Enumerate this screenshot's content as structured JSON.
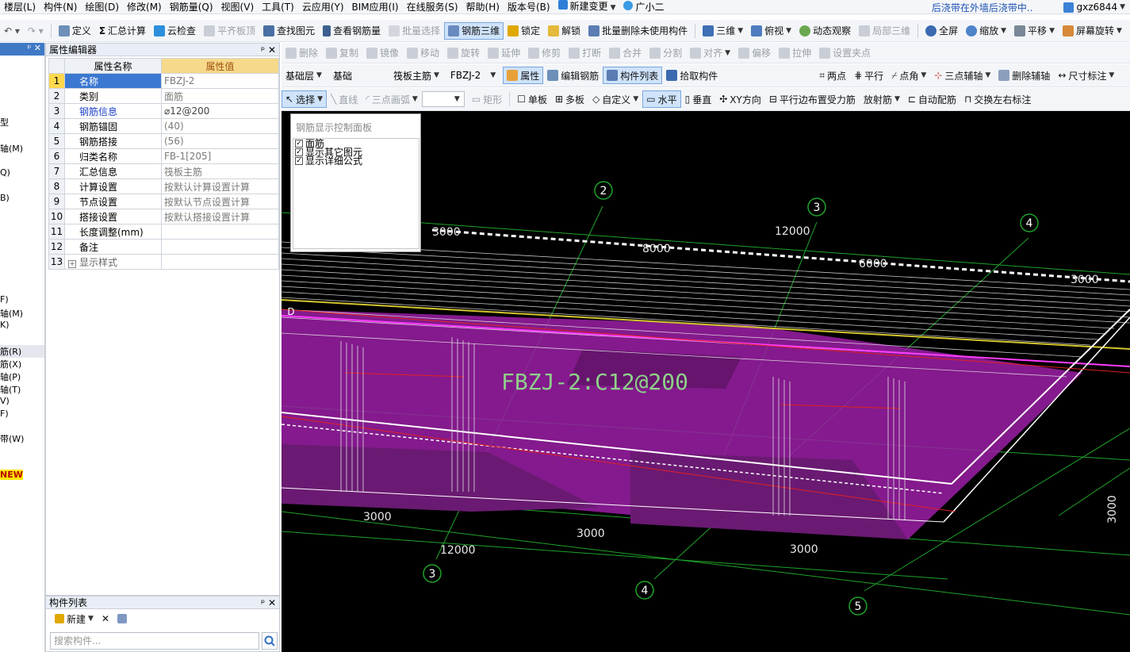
{
  "menubar": {
    "items": [
      "楼层(L)",
      "构件(N)",
      "绘图(D)",
      "修改(M)",
      "钢筋量(Q)",
      "视图(V)",
      "工具(T)",
      "云应用(Y)",
      "BIM应用(I)",
      "在线服务(S)",
      "帮助(H)",
      "版本号(B)",
      "新建变更",
      "广小二"
    ],
    "notice": "后浇带在外墙后浇带中..",
    "user": "gxz6844"
  },
  "toolbar1": {
    "items": [
      "定义",
      "汇总计算",
      "云检查",
      "平齐板顶",
      "查找图元",
      "查看钢筋量",
      "批量选择",
      "钢筋三维",
      "锁定",
      "解锁",
      "批量删除未使用构件",
      "三维",
      "俯视",
      "动态观察",
      "局部三维",
      "全屏",
      "缩放",
      "平移",
      "屏幕旋转"
    ]
  },
  "toolbar2": {
    "items": [
      "删除",
      "复制",
      "镜像",
      "移动",
      "旋转",
      "延伸",
      "修剪",
      "打断",
      "合并",
      "分割",
      "对齐",
      "偏移",
      "拉伸",
      "设置夹点"
    ]
  },
  "toolbar3": {
    "combos": [
      "基础层",
      "基础",
      "筏板主筋",
      "FBZJ-2"
    ],
    "items": [
      "属性",
      "编辑钢筋",
      "构件列表",
      "拾取构件",
      "两点",
      "平行",
      "点角",
      "三点辅轴",
      "删除辅轴",
      "尺寸标注"
    ]
  },
  "toolbar4": {
    "items": [
      "选择",
      "直线",
      "三点画弧",
      "矩形",
      "单板",
      "多板",
      "自定义",
      "水平",
      "垂直",
      "XY方向",
      "平行边布置受力筋",
      "放射筋",
      "自动配筋",
      "交换左右标注"
    ]
  },
  "left_pane": {
    "rows": [
      "型",
      "轴(M)",
      "Q)",
      "B)",
      "F)",
      "轴(M)",
      "K)",
      "筋(R)",
      "筋(X)",
      "轴(P)",
      "轴(T)",
      "V)",
      "F)",
      "带(W)",
      "NEW"
    ]
  },
  "property_editor": {
    "title": "属性编辑器",
    "col_name": "属性名称",
    "col_value": "属性值",
    "rows": [
      {
        "n": "1",
        "name": "名称",
        "value": "FBZJ-2"
      },
      {
        "n": "2",
        "name": "类别",
        "value": "面筋"
      },
      {
        "n": "3",
        "name": "钢筋信息",
        "value": "⌀12@200"
      },
      {
        "n": "4",
        "name": "钢筋锚固",
        "value": "(40)"
      },
      {
        "n": "5",
        "name": "钢筋搭接",
        "value": "(56)"
      },
      {
        "n": "6",
        "name": "归类名称",
        "value": "FB-1[205]"
      },
      {
        "n": "7",
        "name": "汇总信息",
        "value": "筏板主筋"
      },
      {
        "n": "8",
        "name": "计算设置",
        "value": "按默认计算设置计算"
      },
      {
        "n": "9",
        "name": "节点设置",
        "value": "按默认节点设置计算"
      },
      {
        "n": "10",
        "name": "搭接设置",
        "value": "按默认搭接设置计算"
      },
      {
        "n": "11",
        "name": "长度调整(mm)",
        "value": ""
      },
      {
        "n": "12",
        "name": "备注",
        "value": ""
      },
      {
        "n": "13",
        "name": "显示样式",
        "value": ""
      }
    ]
  },
  "component_list": {
    "title": "构件列表",
    "new_label": "新建",
    "search_placeholder": "搜索构件..."
  },
  "rebar_panel": {
    "title": "钢筋显示控制面板",
    "options": [
      "面筋",
      "显示其它图元",
      "显示详细公式"
    ]
  },
  "canvas": {
    "label": "FBZJ-2:C12@200",
    "dims": [
      "3000",
      "8000",
      "12000",
      "6000",
      "3000",
      "3000",
      "3000",
      "12000",
      "3000",
      "3000"
    ],
    "axis_ids": [
      "2",
      "3",
      "4",
      "3",
      "4",
      "5",
      "D"
    ]
  },
  "colors": {
    "slab": "#9b1fa6",
    "label": "#8fd18a",
    "axis": "#1fa32a",
    "rebar": "#e8e8e8"
  }
}
